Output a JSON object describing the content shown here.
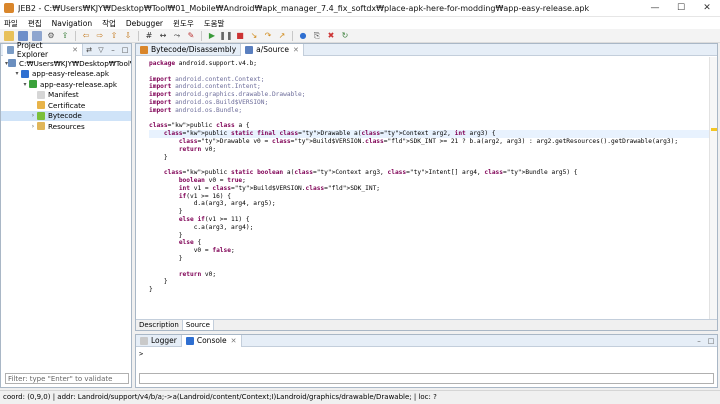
{
  "window": {
    "title": "JEB2 - C:₩Users₩KJY₩Desktop₩Tool₩01_Mobile₩Android₩apk_manager_7.4_fix_softdx₩place-apk-here-for-modding₩app-easy-release.apk"
  },
  "menu": [
    "파일",
    "편집",
    "Navigation",
    "작업",
    "Debugger",
    "윈도우",
    "도움말"
  ],
  "project_explorer": {
    "tab_label": "Project Explorer",
    "tree": [
      {
        "label": "C:₩Users₩KJY₩Desktop₩Tool₩",
        "depth": 0,
        "arrow": "▾",
        "icon_color": "#6b8fbf"
      },
      {
        "label": "app-easy-release.apk",
        "depth": 1,
        "arrow": "▾",
        "icon_color": "#2f6fd1"
      },
      {
        "label": "app-easy-release.apk",
        "depth": 2,
        "arrow": "▾",
        "icon_color": "#3aa13a"
      },
      {
        "label": "Manifest",
        "depth": 3,
        "arrow": "",
        "icon_color": "#d6d6d6"
      },
      {
        "label": "Certificate",
        "depth": 3,
        "arrow": "",
        "icon_color": "#e8b44a"
      },
      {
        "label": "Bytecode",
        "depth": 3,
        "arrow": "›",
        "icon_color": "#7bbf3a"
      },
      {
        "label": "Resources",
        "depth": 3,
        "arrow": "›",
        "icon_color": "#e0b65a"
      }
    ],
    "filter_placeholder": "Filter: type \"Enter\" to validate"
  },
  "editor": {
    "tabs": [
      {
        "label": "Bytecode/Disassembly",
        "active": false
      },
      {
        "label": "a/Source",
        "active": true
      }
    ],
    "bottom_tabs": [
      {
        "label": "Description",
        "active": false
      },
      {
        "label": "Source",
        "active": true
      }
    ],
    "code_lines": [
      "package android.support.v4.b;",
      "",
      "import android.content.Context;",
      "import android.content.Intent;",
      "import android.graphics.drawable.Drawable;",
      "import android.os.Build$VERSION;",
      "import android.os.Bundle;",
      "",
      "public class a {",
      "    public static final Drawable a(Context arg2, int arg3) {",
      "        Drawable v0 = Build$VERSION.SDK_INT >= 21 ? b.a(arg2, arg3) : arg2.getResources().getDrawable(arg3);",
      "        return v0;",
      "    }",
      "",
      "    public static boolean a(Context arg3, Intent[] arg4, Bundle arg5) {",
      "        boolean v0 = true;",
      "        int v1 = Build$VERSION.SDK_INT;",
      "        if(v1 >= 16) {",
      "            d.a(arg3, arg4, arg5);",
      "        }",
      "        else if(v1 >= 11) {",
      "            c.a(arg3, arg4);",
      "        }",
      "        else {",
      "            v0 = false;",
      "        }",
      "",
      "        return v0;",
      "    }",
      "}"
    ],
    "highlight_line": 9
  },
  "console": {
    "tabs": [
      {
        "label": "Logger",
        "active": false,
        "icon_color": "#c9c9c9"
      },
      {
        "label": "Console",
        "active": true,
        "icon_color": "#2f6fd1"
      }
    ],
    "prompt": ">"
  },
  "status_bar": {
    "text": "coord: (0,9,0) | addr: Landroid/support/v4/b/a;->a(Landroid/content/Context;I)Landroid/graphics/drawable/Drawable; | loc: ?"
  },
  "colors": {
    "keyword": "#7f0055",
    "type": "#6c6c9a",
    "field": "#0000c0",
    "selection": "#cfe3f8"
  }
}
